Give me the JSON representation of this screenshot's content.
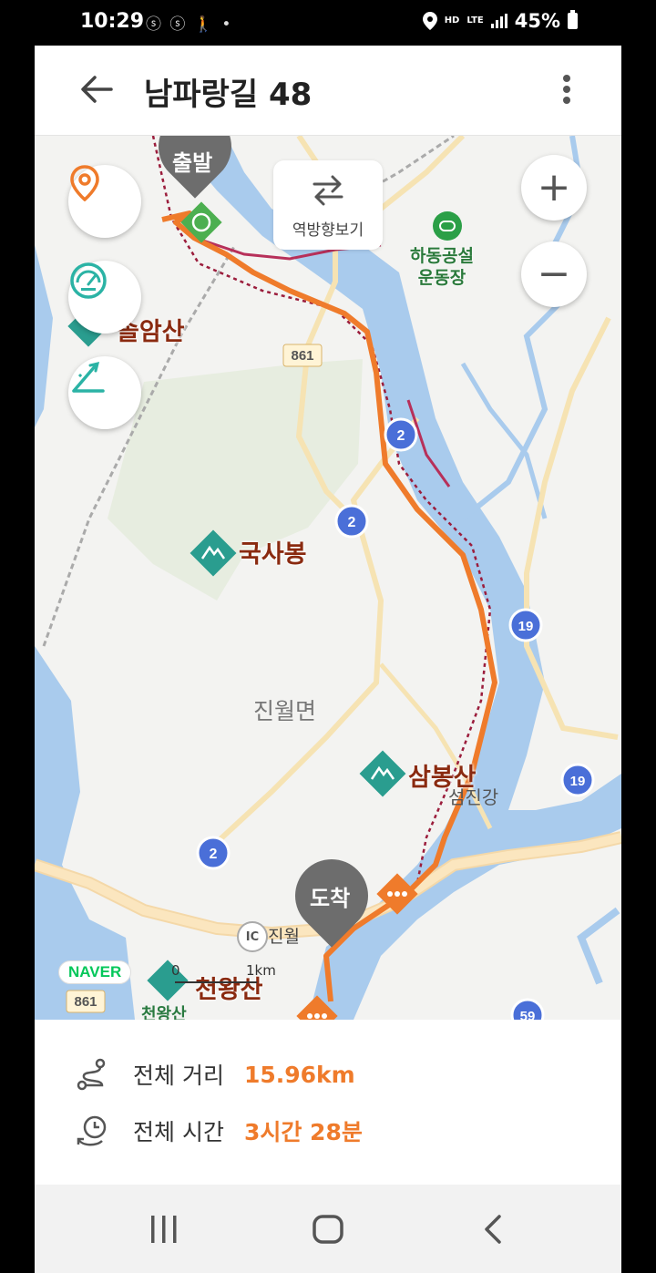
{
  "status_bar": {
    "time": "10:29",
    "notifications": "ⓢ ⓢ 🚶 •",
    "hd_voice": "HD",
    "lte": "LTE",
    "battery": "45%"
  },
  "header": {
    "title": "남파랑길 48"
  },
  "map": {
    "reverse_label": "역방향보기",
    "labels": {
      "start": "출발",
      "end": "도착",
      "gugsabong": "국사봉",
      "sambongsan": "삼봉산",
      "seomjingang": "섬진강",
      "jinwol_myeon": "진월면",
      "sports_field": "하동공설\n운동장",
      "cheonwangsan": "천왕산",
      "cheonwangsan_small": "천왕산",
      "partial_peak": "솔암산",
      "ic_jinwol": "진월",
      "ic_badge": "IC",
      "road_861_top": "861",
      "road_861_bottom": "861",
      "road_2_a": "2",
      "road_2_b": "2",
      "road_2_c": "2",
      "road_19_a": "19",
      "road_19_b": "19",
      "road_59": "59",
      "naver": "NAVER",
      "scale_zero": "0",
      "scale_1km": "1km"
    },
    "zoom_in": "+",
    "zoom_out": "−"
  },
  "summary": {
    "distance_label": "전체 거리",
    "distance_value": "15.96km",
    "time_label": "전체 시간",
    "time_value": "3시간 28분"
  },
  "colors": {
    "route": "#ef7b2b",
    "river": "#a9cbed",
    "accent_teal": "#2bb3a5",
    "peak_green": "#2a9d8f"
  },
  "icons": [
    "back-arrow-icon",
    "kebab-menu-icon",
    "location-pin-icon",
    "speedometer-icon",
    "elevation-icon",
    "reverse-arrows-icon",
    "zoom-in-icon",
    "zoom-out-icon",
    "distance-route-icon",
    "clock-icon",
    "recents-icon",
    "home-icon",
    "nav-back-icon"
  ]
}
